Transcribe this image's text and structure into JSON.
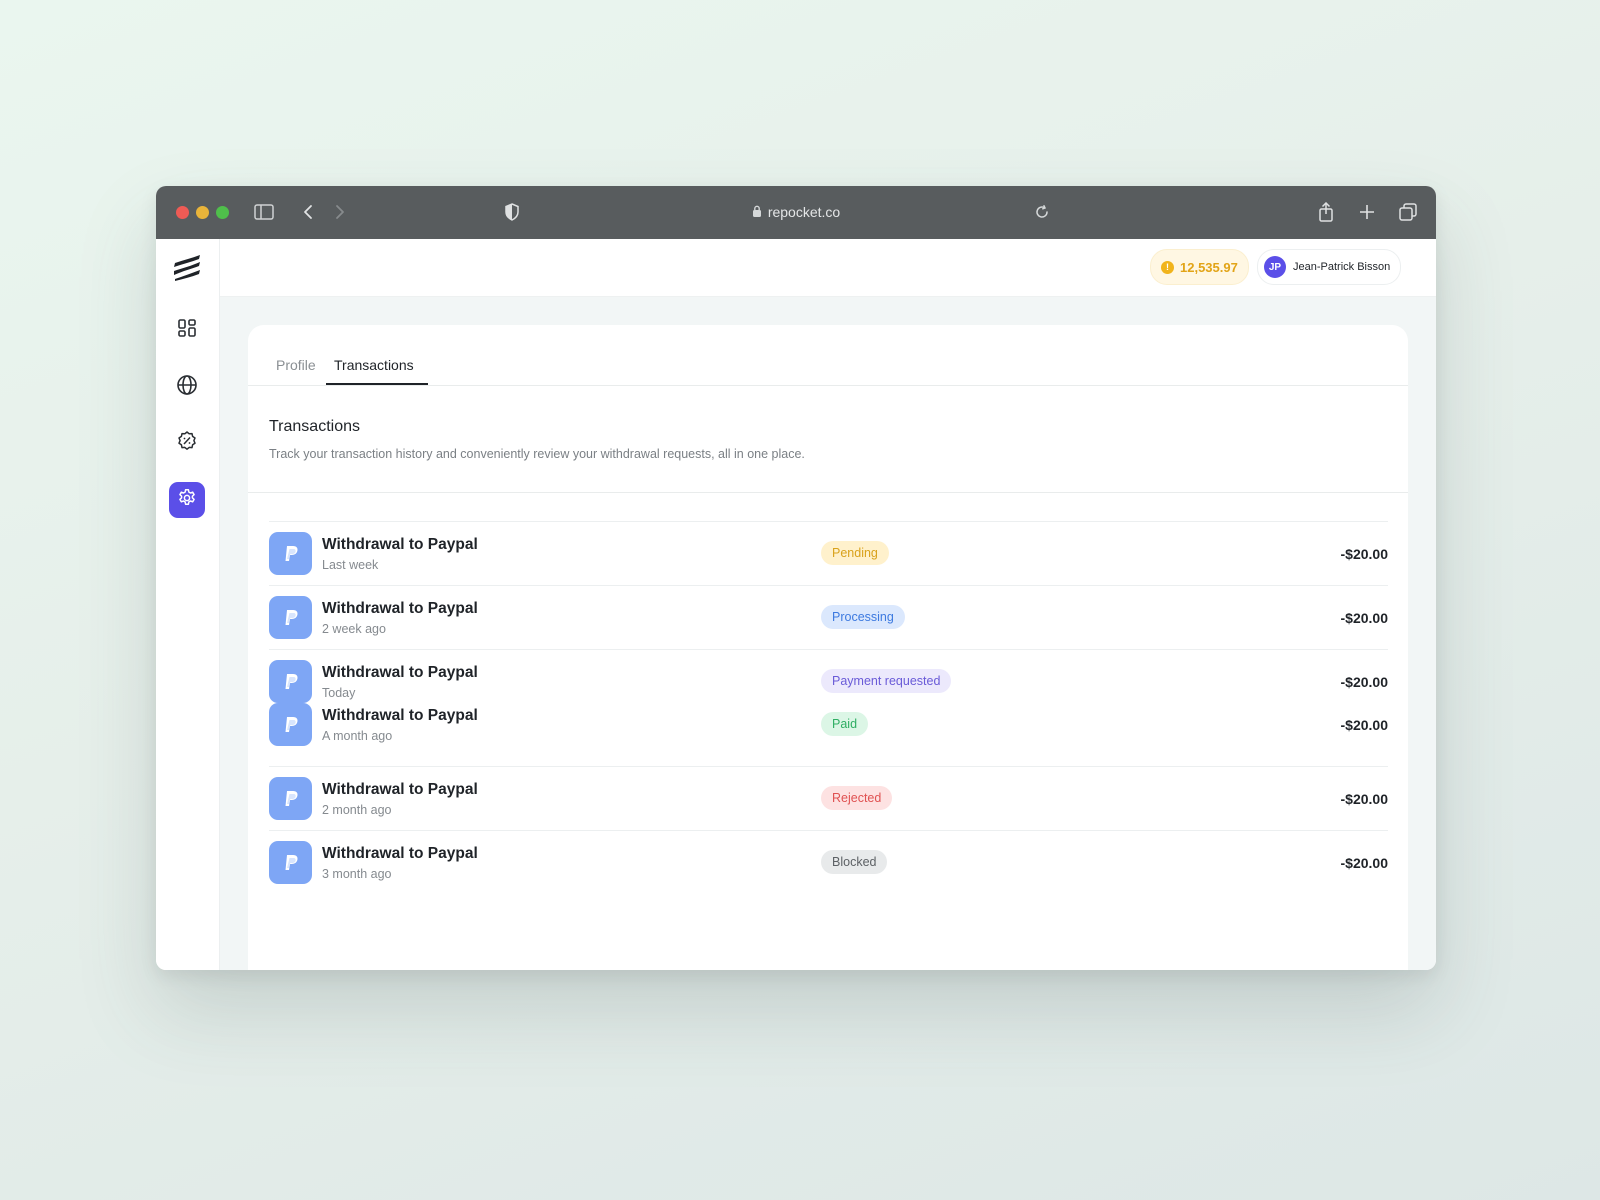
{
  "browser": {
    "url": "repocket.co"
  },
  "header": {
    "balance": "12,535.97",
    "user": {
      "initials": "JP",
      "name": "Jean-Patrick Bisson"
    }
  },
  "sidebar": {
    "items": [
      {
        "icon": "dashboard-icon"
      },
      {
        "icon": "globe-icon"
      },
      {
        "icon": "discount-icon"
      },
      {
        "icon": "gear-icon",
        "active": true
      }
    ]
  },
  "tabs": [
    {
      "label": "Profile"
    },
    {
      "label": "Transactions",
      "active": true
    }
  ],
  "section": {
    "title": "Transactions",
    "description": "Track your transaction history and conveniently review your withdrawal requests, all in one place."
  },
  "transactions": [
    {
      "title": "Withdrawal to Paypal",
      "date": "Last week",
      "status": "Pending",
      "amount": "-$20.00",
      "status_bg": "#fff1cc",
      "status_fg": "#d9a21c"
    },
    {
      "title": "Withdrawal to Paypal",
      "date": "2 week ago",
      "status": "Processing",
      "amount": "-$20.00",
      "status_bg": "#dbe8fd",
      "status_fg": "#3d7ae0"
    },
    {
      "title": "Withdrawal to Paypal",
      "date": "Today",
      "status": "Payment requested",
      "amount": "-$20.00",
      "status_bg": "#ece9fc",
      "status_fg": "#6a5bd8"
    },
    {
      "title": "Withdrawal to Paypal",
      "date": "A month ago",
      "status": "Paid",
      "amount": "-$20.00",
      "status_bg": "#dcf6e6",
      "status_fg": "#2fae63"
    },
    {
      "title": "Withdrawal to Paypal",
      "date": "2 month ago",
      "status": "Rejected",
      "amount": "-$20.00",
      "status_bg": "#fde2e2",
      "status_fg": "#e05252"
    },
    {
      "title": "Withdrawal to Paypal",
      "date": "3 month ago",
      "status": "Blocked",
      "amount": "-$20.00",
      "status_bg": "#e8eaeb",
      "status_fg": "#5d6165"
    }
  ]
}
